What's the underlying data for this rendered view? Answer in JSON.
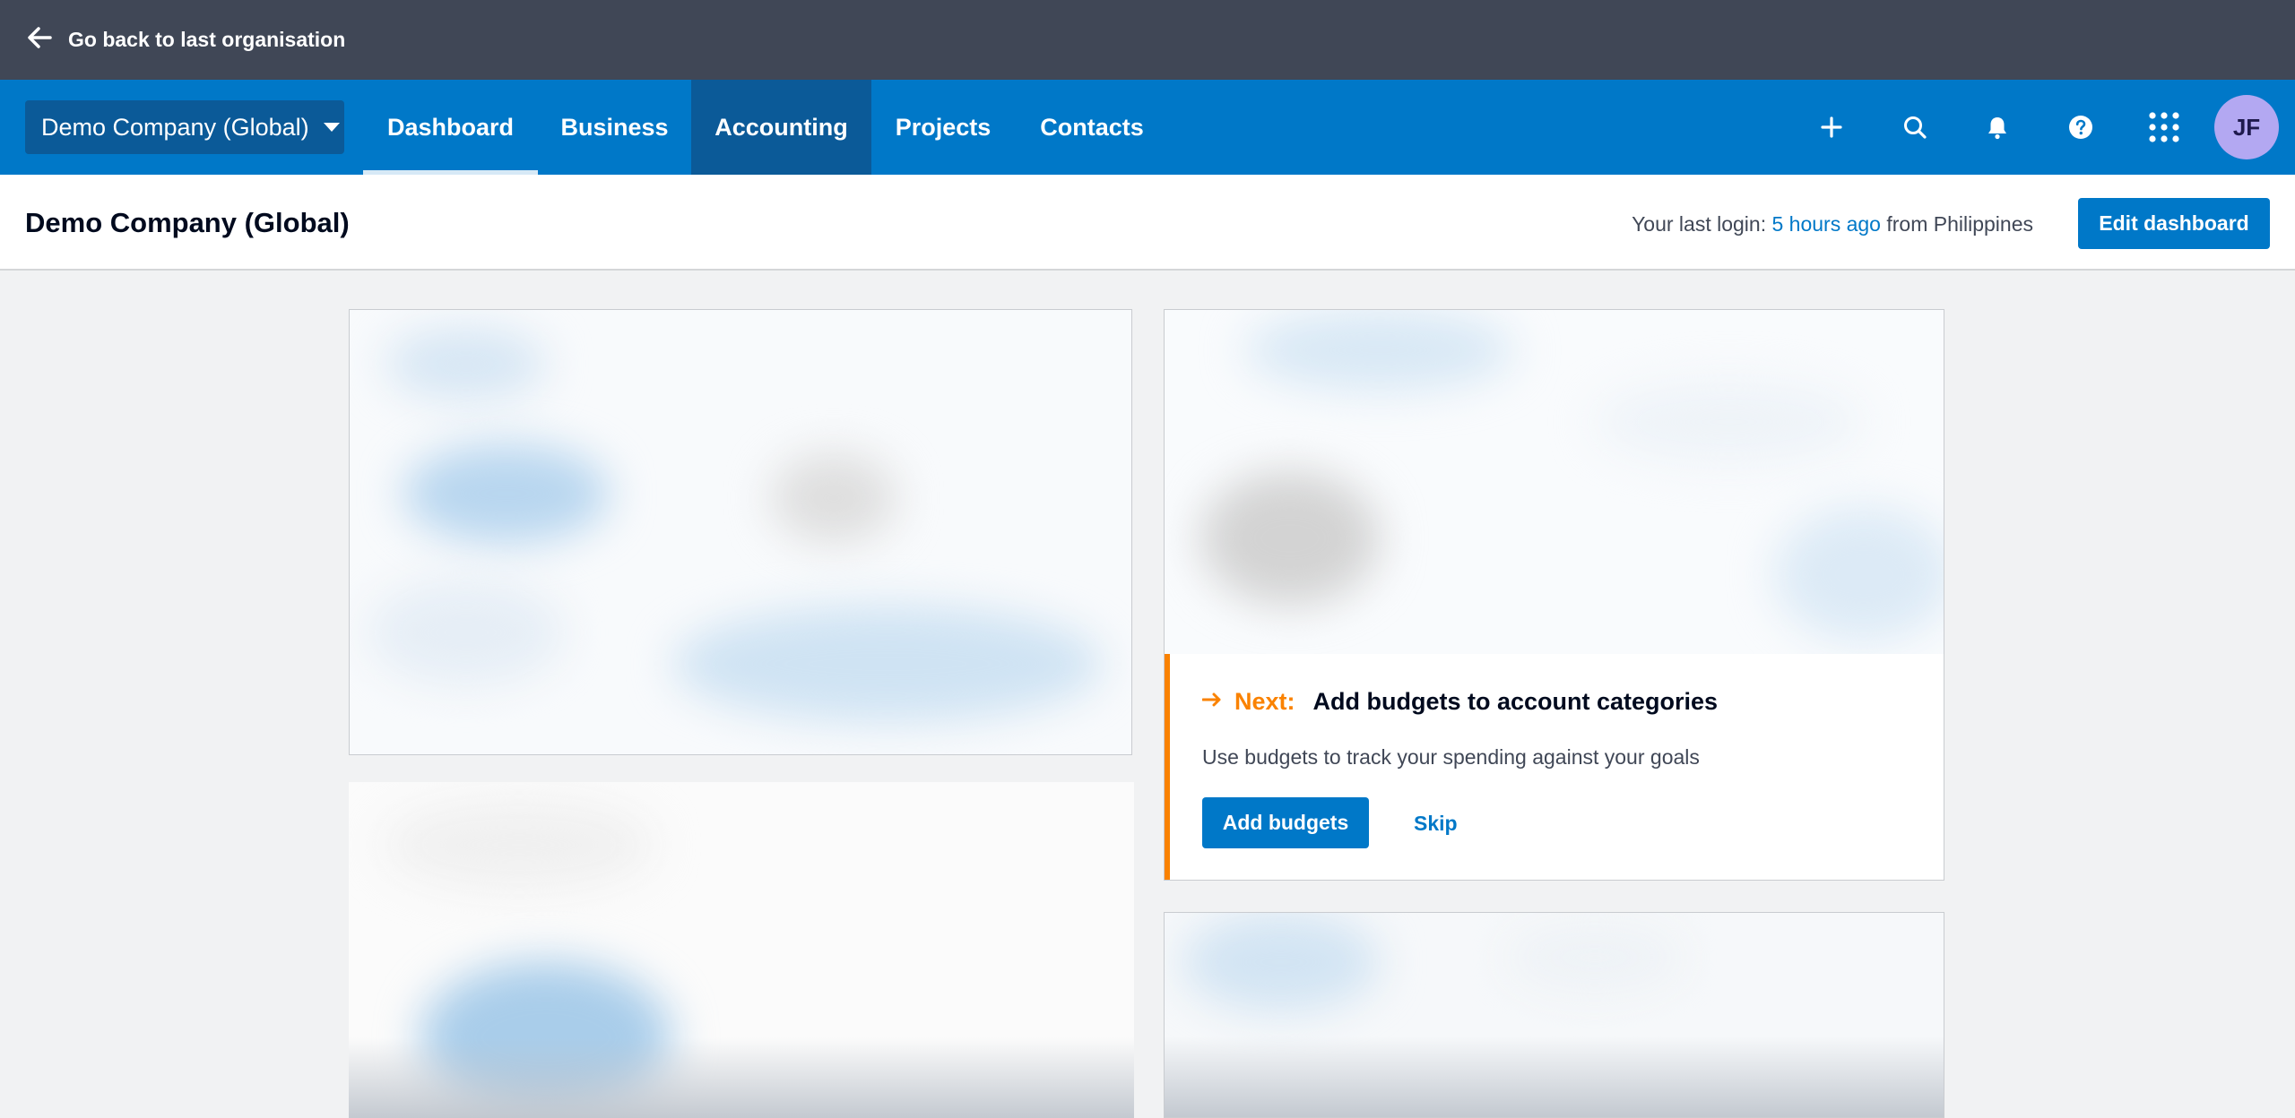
{
  "topbar": {
    "back_label": "Go back to last organisation"
  },
  "nav": {
    "org_name": "Demo Company (Global)",
    "tabs": [
      "Dashboard",
      "Business",
      "Accounting",
      "Projects",
      "Contacts"
    ],
    "avatar_initials": "JF",
    "icons": [
      "plus-icon",
      "search-icon",
      "bell-icon",
      "help-icon",
      "apps-grid-icon"
    ]
  },
  "header": {
    "title": "Demo Company (Global)",
    "last_login_prefix": "Your last login: ",
    "last_login_link": "5 hours ago",
    "last_login_suffix": " from Philippines",
    "edit_button": "Edit dashboard"
  },
  "next_card": {
    "label": "Next:",
    "title": "Add budgets to account categories",
    "description": "Use budgets to track your spending against your goals",
    "primary_button": "Add budgets",
    "skip_link": "Skip"
  },
  "colors": {
    "nav_blue": "#0078c8",
    "accent_orange": "#fa8200",
    "topbar": "#404756"
  }
}
